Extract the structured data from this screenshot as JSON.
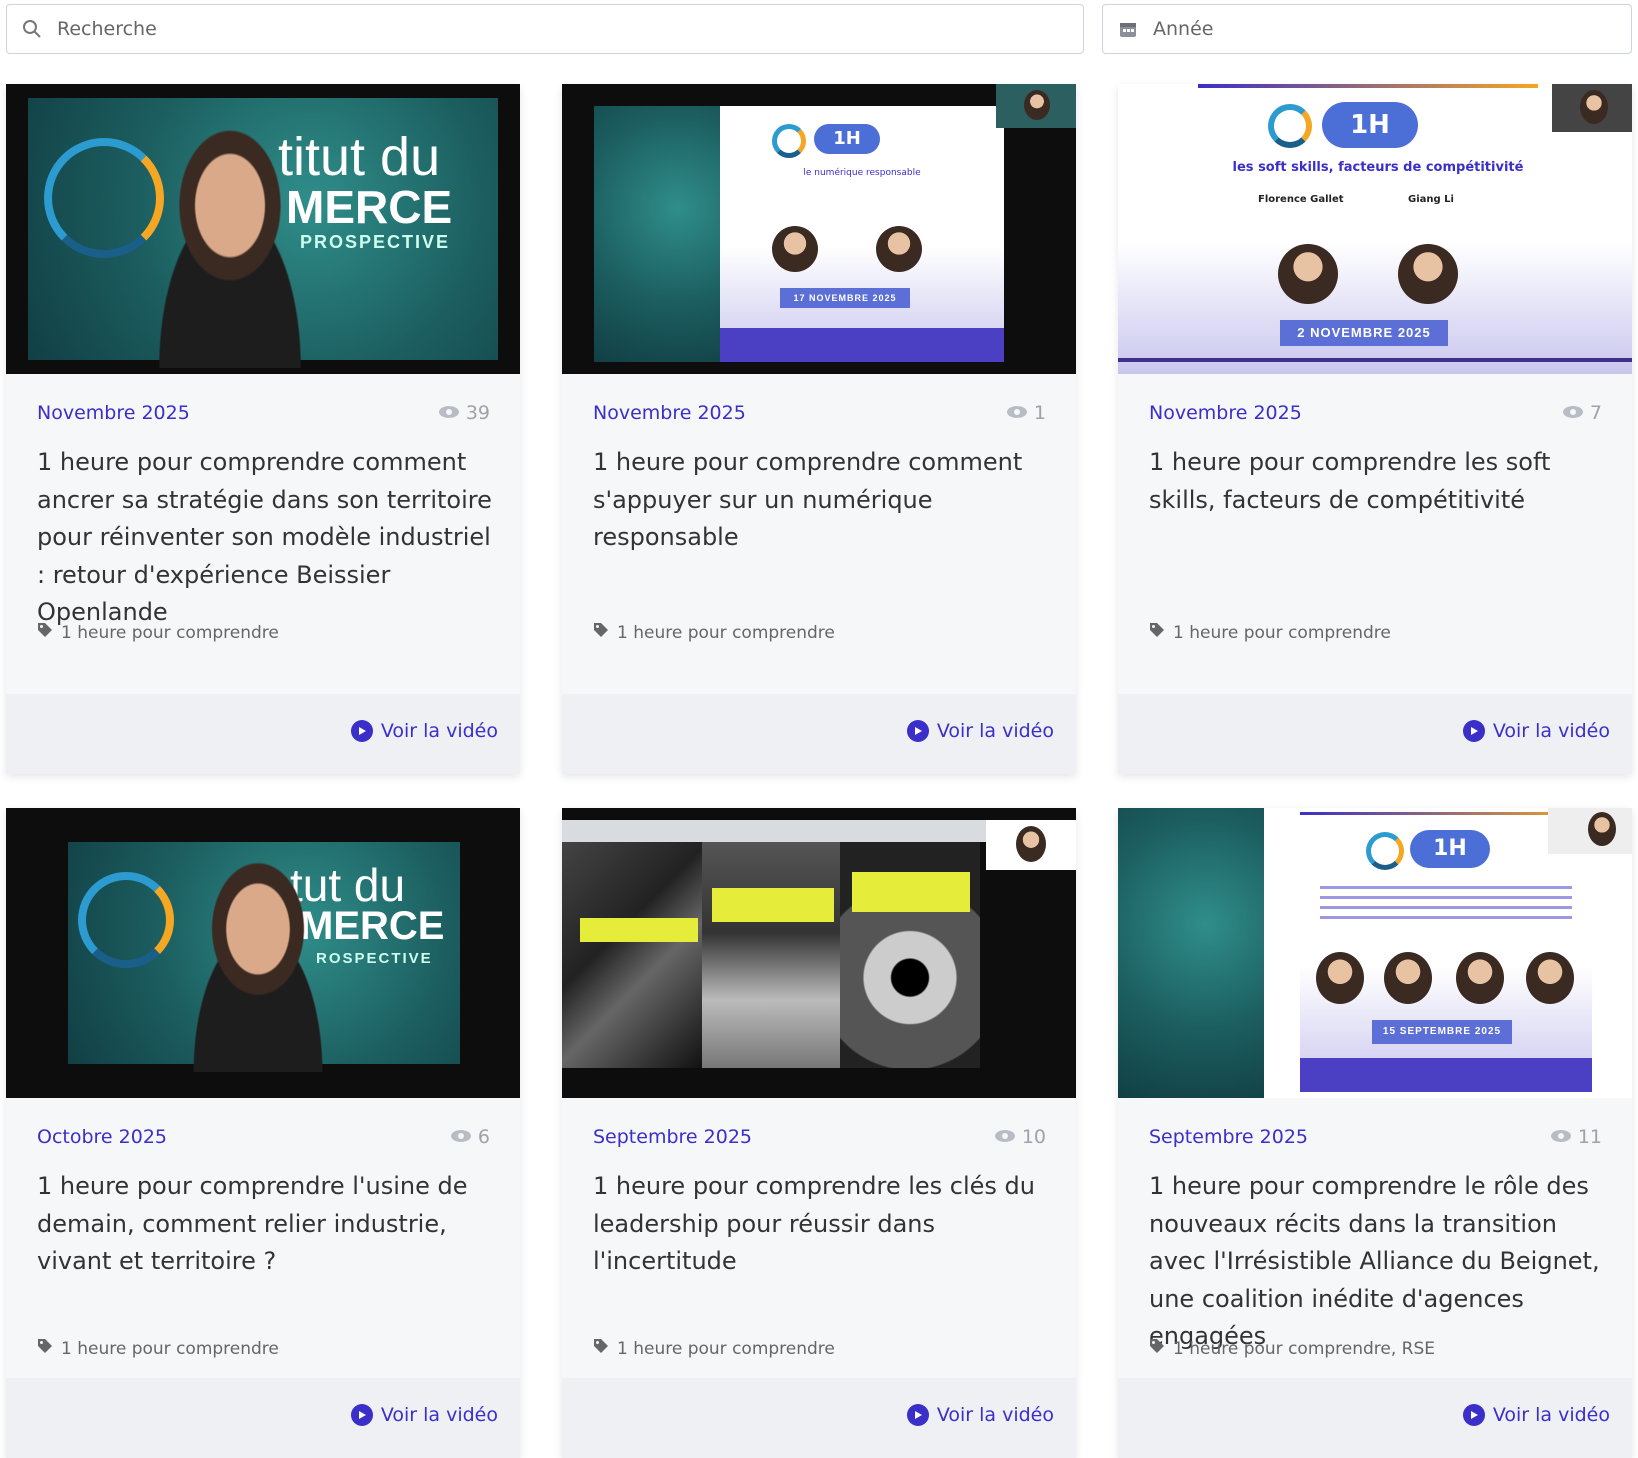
{
  "search": {
    "placeholder": "Recherche",
    "icon": "search-icon"
  },
  "year_filter": {
    "placeholder": "Année",
    "icon": "calendar-icon"
  },
  "watch_label": "Voir la vidéo",
  "colors": {
    "accent": "#3b2fc9",
    "card_bg": "#f6f7f9",
    "footer_bg": "#eef0f3"
  },
  "thumbnails": {
    "c1": {
      "line1": "titut du",
      "line2": "MERCE",
      "line3": "PROSPECTIVE"
    },
    "c2": {
      "badge": "1H",
      "subtitle": "le numérique responsable",
      "date_banner": "17 NOVEMBRE 2025"
    },
    "c3": {
      "badge": "1H",
      "subtitle": "les soft skills, facteurs de compétitivité",
      "speaker1": "Florence Gallet",
      "speaker2": "Giang Li",
      "date_banner": "2 NOVEMBRE 2025"
    },
    "c4": {
      "line1": "tut du",
      "line2": "MERCE",
      "line3": "ROSPECTIVE"
    },
    "c6": {
      "badge": "1H",
      "date_banner": "15 SEPTEMBRE 2025"
    }
  },
  "cards": [
    {
      "date": "Novembre 2025",
      "views": "39",
      "title": "1 heure pour comprendre comment ancrer sa stratégie dans son territoire pour réinventer son modèle industriel : retour d'expérience Beissier Openlande",
      "tags": "1 heure pour comprendre"
    },
    {
      "date": "Novembre 2025",
      "views": "1",
      "title": "1 heure pour comprendre comment s'appuyer sur un numérique responsable",
      "tags": "1 heure pour comprendre"
    },
    {
      "date": "Novembre 2025",
      "views": "7",
      "title": "1 heure pour comprendre les soft skills, facteurs de compétitivité",
      "tags": "1 heure pour comprendre"
    },
    {
      "date": "Octobre 2025",
      "views": "6",
      "title": "1 heure pour comprendre l'usine de demain, comment relier industrie, vivant et territoire ?",
      "tags": "1 heure pour comprendre"
    },
    {
      "date": "Septembre 2025",
      "views": "10",
      "title": "1 heure pour comprendre les clés du leadership pour réussir dans l'incertitude",
      "tags": "1 heure pour comprendre"
    },
    {
      "date": "Septembre 2025",
      "views": "11",
      "title": "1 heure pour comprendre le rôle des nouveaux récits dans la transition avec l'Irrésistible Alliance du Beignet, une coalition inédite d'agences engagées",
      "tags": "1 heure pour comprendre, RSE"
    }
  ]
}
